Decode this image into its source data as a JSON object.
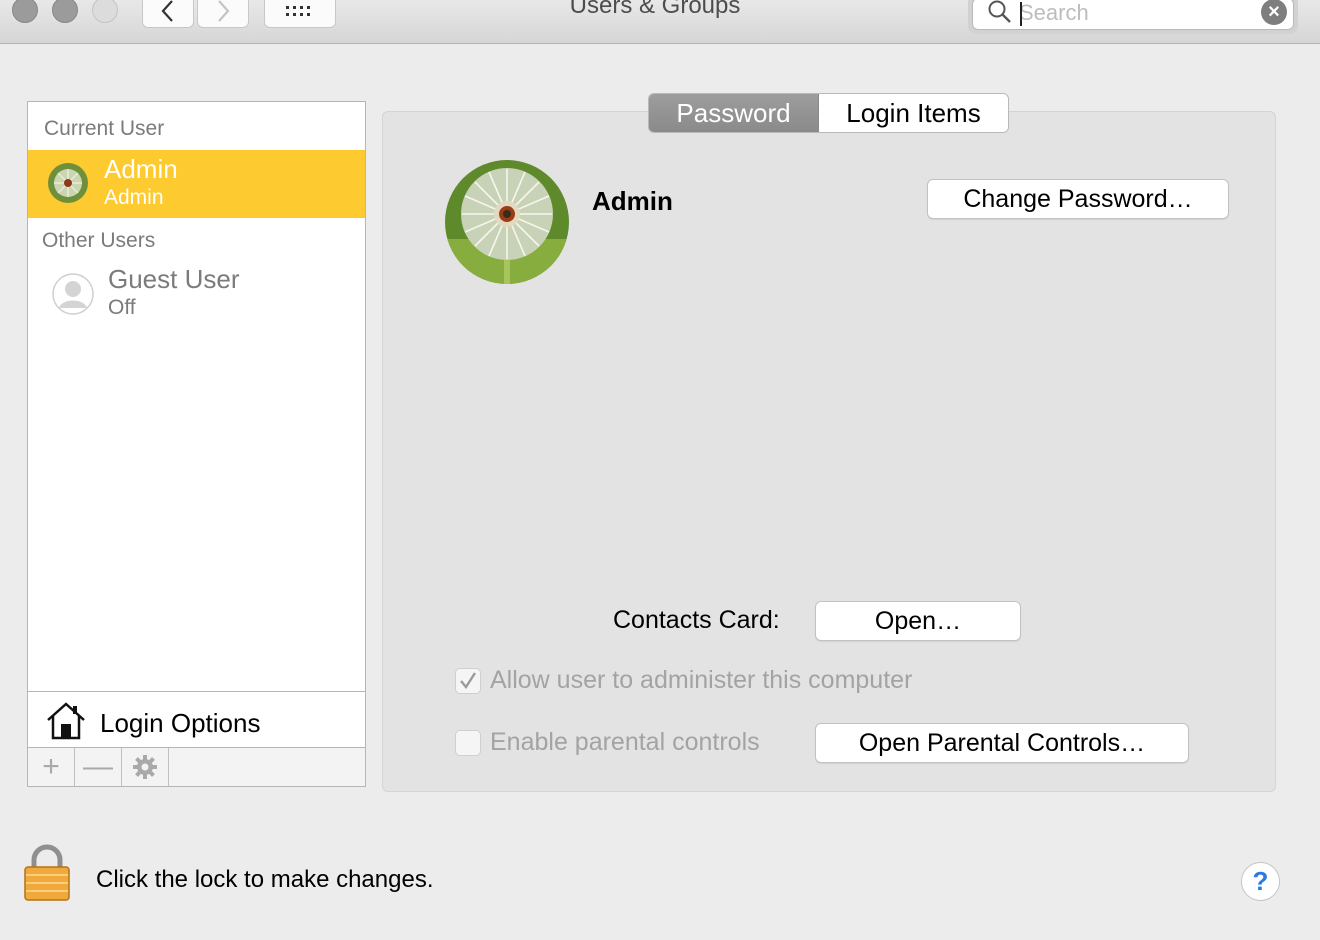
{
  "window": {
    "title": "Users & Groups",
    "search_placeholder": "Search"
  },
  "sidebar": {
    "current_user_header": "Current User",
    "current_user": {
      "name": "Admin",
      "role": "Admin"
    },
    "other_users_header": "Other Users",
    "other_users": [
      {
        "name": "Guest User",
        "status": "Off"
      }
    ],
    "login_options_label": "Login Options",
    "add_label": "+",
    "remove_label": "—"
  },
  "tabs": [
    {
      "label": "Password",
      "active": true
    },
    {
      "label": "Login Items",
      "active": false
    }
  ],
  "detail": {
    "user_name": "Admin",
    "change_password_label": "Change Password…",
    "contacts_card_label": "Contacts Card:",
    "open_label": "Open…",
    "allow_admin_label": "Allow user to administer this computer",
    "allow_admin_checked": true,
    "parental_controls_label": "Enable parental controls",
    "parental_controls_checked": false,
    "open_parental_controls_label": "Open Parental Controls…"
  },
  "footer": {
    "lock_text": "Click the lock to make changes.",
    "help_label": "?"
  },
  "colors": {
    "selection": "#fdca30",
    "tab_active": "#8f8f8f",
    "help_accent": "#2a7ae2"
  }
}
